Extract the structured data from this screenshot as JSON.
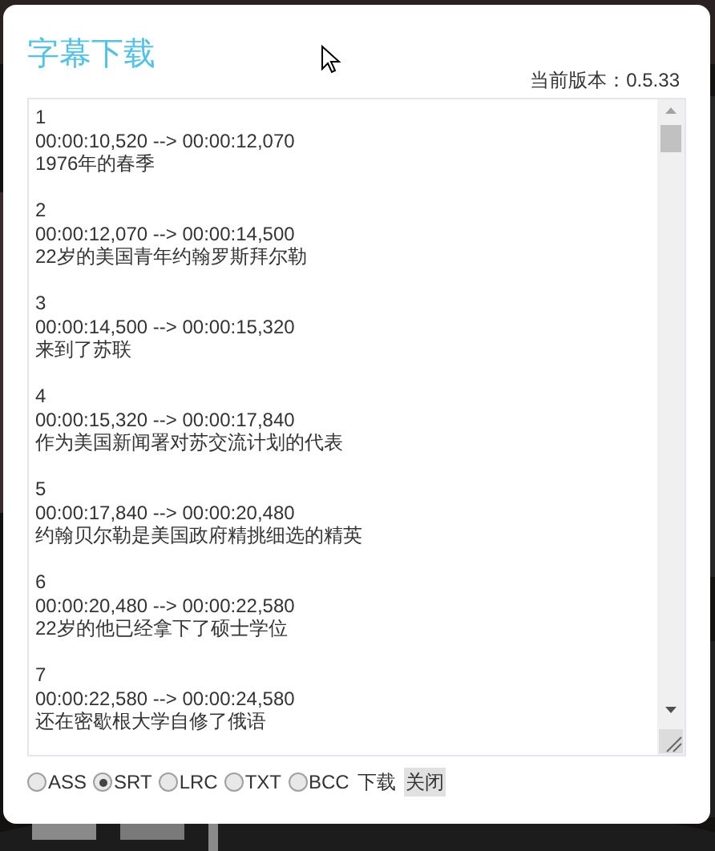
{
  "dialog": {
    "title": "字幕下载",
    "version": "当前版本：0.5.33"
  },
  "subtitles": [
    {
      "index": "1",
      "time": "00:00:10,520 --> 00:00:12,070",
      "text": "1976年的春季"
    },
    {
      "index": "2",
      "time": "00:00:12,070 --> 00:00:14,500",
      "text": "22岁的美国青年约翰罗斯拜尔勒"
    },
    {
      "index": "3",
      "time": "00:00:14,500 --> 00:00:15,320",
      "text": "来到了苏联"
    },
    {
      "index": "4",
      "time": "00:00:15,320 --> 00:00:17,840",
      "text": "作为美国新闻署对苏交流计划的代表"
    },
    {
      "index": "5",
      "time": "00:00:17,840 --> 00:00:20,480",
      "text": "约翰贝尔勒是美国政府精挑细选的精英"
    },
    {
      "index": "6",
      "time": "00:00:20,480 --> 00:00:22,580",
      "text": "22岁的他已经拿下了硕士学位"
    },
    {
      "index": "7",
      "time": "00:00:22,580 --> 00:00:24,580",
      "text": "还在密歇根大学自修了俄语"
    }
  ],
  "formats": [
    {
      "label": "ASS",
      "selected": false
    },
    {
      "label": "SRT",
      "selected": true
    },
    {
      "label": "LRC",
      "selected": false
    },
    {
      "label": "TXT",
      "selected": false
    },
    {
      "label": "BCC",
      "selected": false
    }
  ],
  "download": "下载",
  "close": "关闭"
}
